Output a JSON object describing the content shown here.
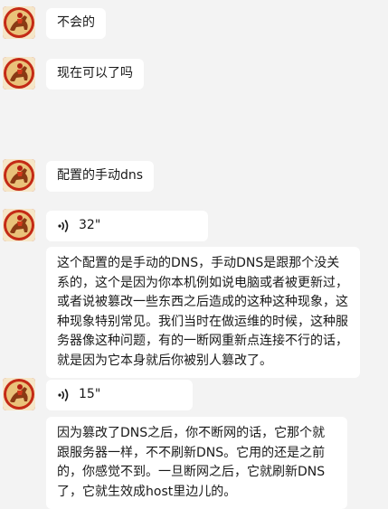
{
  "chat": {
    "messages": [
      {
        "type": "text",
        "text": "不会的"
      },
      {
        "type": "text",
        "text": "现在可以了吗"
      },
      {
        "type": "text",
        "text": "配置的手动dns"
      },
      {
        "type": "voice",
        "duration": "32\"",
        "transcript": "这个配置的是手动的DNS，手动DNS是跟那个没关系的，这个是因为你本机例如说电脑或者被更新过，或者说被篡改一些东西之后造成的这种这种现象，这种现象特别常见。我们当时在做运维的时候，这种服务器像这种问题，有的一断网重新点连接不行的话，就是因为它本身就后你被别人篡改了。"
      },
      {
        "type": "voice",
        "duration": "15\"",
        "transcript": "因为篡改了DNS之后，你不断网的话，它那个就跟服务器一样，不不刷新DNS。它用的还是之前的，你感觉不到。一旦断网之后，它就刷新DNS了，它就生效成host里边儿的。"
      }
    ]
  },
  "icons": {
    "avatar": "horse-rider-avatar-icon",
    "voice": "voice-wave-icon"
  },
  "colors": {
    "background": "#f3f3f3",
    "bubble": "#ffffff",
    "text": "#191919",
    "avatar_bg": "#b21e12"
  }
}
